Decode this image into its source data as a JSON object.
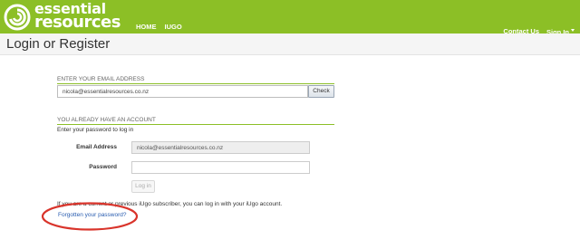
{
  "header": {
    "logo_line1": "essential",
    "logo_line2": "resources",
    "nav_left": [
      "HOME",
      "IUGO"
    ],
    "nav_right": {
      "contact": "Contact Us",
      "signin": "Sign In"
    },
    "brand_color": "#8cbf26"
  },
  "page": {
    "title": "Login or Register"
  },
  "email_section": {
    "label": "ENTER YOUR EMAIL ADDRESS",
    "email_value": "nicola@essentialresources.co.nz",
    "check_label": "Check"
  },
  "account_section": {
    "label": "YOU ALREADY HAVE AN ACCOUNT",
    "instruction": "Enter your password to log in",
    "email_label": "Email Address",
    "email_value": "nicola@essentialresources.co.nz",
    "password_label": "Password",
    "password_value": "",
    "login_label": "Log in",
    "iugo_note": "If you are a current or previous iUgo subscriber, you can log in with your iUgo account.",
    "forgot_label": "Forgotten your password?"
  },
  "annotation": {
    "ellipse_color": "#d9342b"
  }
}
